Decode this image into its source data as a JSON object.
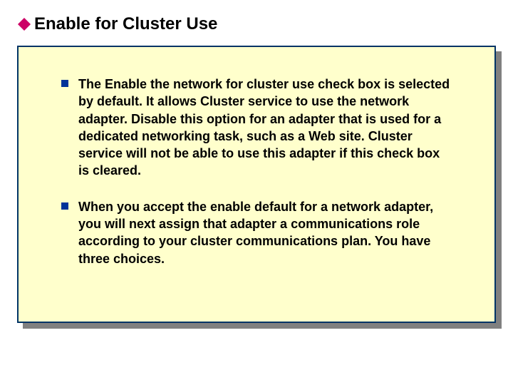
{
  "title": "Enable for Cluster Use",
  "bullets": [
    "The Enable the network for cluster use check box is selected by default. It allows Cluster service to use the network adapter. Disable this option for an adapter that is used for a dedicated networking task, such as a Web site. Cluster service will not be able to use this adapter if this check box is cleared.",
    "When you accept the enable default for a network adapter, you will next assign that adapter a communications role according to your cluster communications plan. You have three choices."
  ],
  "colors": {
    "panel_bg": "#ffffcc",
    "panel_border": "#003366",
    "bullet_square": "#003399",
    "title_diamond": "#cc0066",
    "shadow": "#808080"
  }
}
